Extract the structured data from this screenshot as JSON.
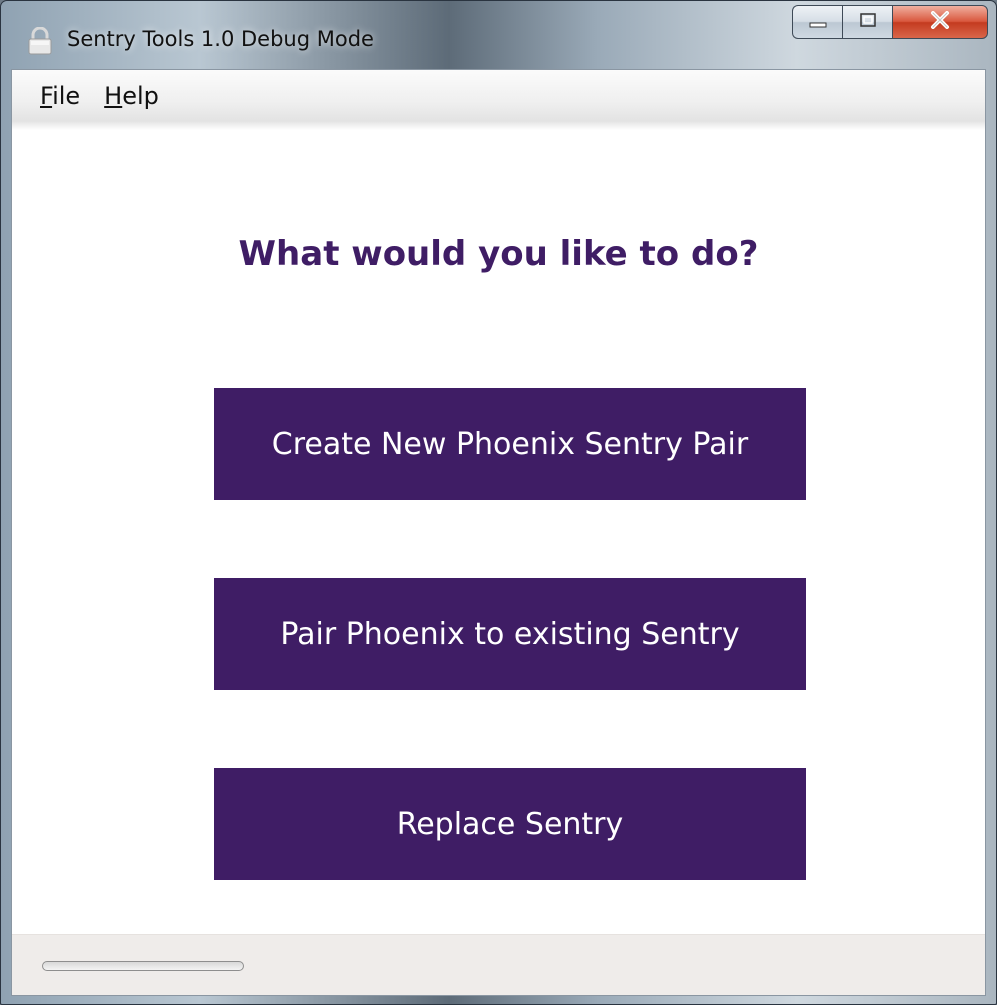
{
  "window": {
    "title": "Sentry Tools 1.0 Debug Mode"
  },
  "menu": {
    "file": {
      "mnemonic": "F",
      "rest": "ile"
    },
    "help": {
      "mnemonic": "H",
      "rest": "elp"
    }
  },
  "main": {
    "heading": "What would you like to do?",
    "buttons": [
      {
        "label": "Create New Phoenix Sentry Pair"
      },
      {
        "label": "Pair Phoenix to existing Sentry"
      },
      {
        "label": "Replace Sentry"
      }
    ]
  },
  "status": {
    "progress_fraction": 0
  },
  "colors": {
    "accent": "#3f1d65",
    "button_text": "#ffffff",
    "statusbar_bg": "#efecea"
  },
  "icons": {
    "app": "lock-icon",
    "minimize": "minimize-icon",
    "maximize": "maximize-icon",
    "close": "close-icon"
  }
}
